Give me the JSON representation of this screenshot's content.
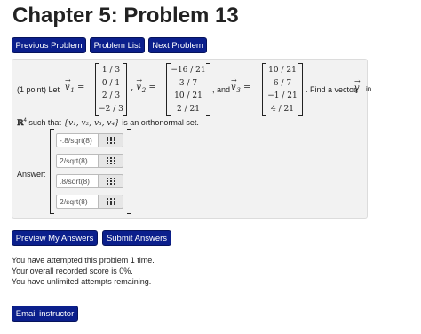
{
  "title": "Chapter 5: Problem 13",
  "nav": {
    "previous": "Previous Problem",
    "list": "Problem List",
    "next": "Next Problem"
  },
  "problem": {
    "intro": "(1 point) Let",
    "v1_label": "v",
    "v1_sub": "1",
    "v1": [
      "1 / 3",
      "0 / 1",
      "2 / 3",
      "−2 / 3"
    ],
    "v2_label": "v",
    "v2_sub": "2",
    "v2": [
      "−16 / 21",
      "3 / 7",
      "10 / 21",
      "2 / 21"
    ],
    "and_text": ", and",
    "v3_label": "v",
    "v3_sub": "3",
    "v3": [
      "10 / 21",
      "6 / 7",
      "−1 / 21",
      "4 / 21"
    ],
    "find_text": ". Find a vector",
    "v4_label": "v",
    "v4_sub": "4",
    "in_text": "in",
    "space": "ℝ",
    "space_exp": "4",
    "such_text": "such that",
    "set_text": "{v₁, v₂, v₃, v₄}",
    "ortho_text": "is an orthonormal set."
  },
  "answer": {
    "label": "Answer:",
    "entries": [
      ".8/sqrt(8)",
      "2/sqrt(8)",
      ".8/sqrt(8)",
      "2/sqrt(8)"
    ],
    "entries_prefix_first": "-"
  },
  "actions": {
    "preview": "Preview My Answers",
    "submit": "Submit Answers"
  },
  "info": {
    "attempts": "You have attempted this problem 1 time.",
    "score": "Your overall recorded score is 0%.",
    "remaining": "You have unlimited attempts remaining."
  },
  "email": "Email instructor",
  "colors": {
    "button_bg": "#0b1f8c",
    "panel_bg": "#f2f2f2"
  }
}
